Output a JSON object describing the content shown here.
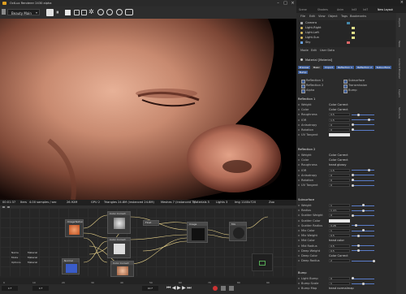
{
  "render_window": {
    "title": "OctLux Renderer 2430 alpha",
    "pass_select": "Beauty Main",
    "stats": {
      "time": "00:01:37",
      "iters": "Iters",
      "samples": "4.00 samples / sec",
      "spp": "26.92M",
      "gpu": "GPU 2",
      "triangles": "Triangles 24.8M (instanced 24.8M)",
      "meshes": "Meshes 7 (instanced 7)",
      "materials": "Materials 5",
      "lights": "Lights 3",
      "img": "Img 1140x720",
      "zoom": "Zoo"
    }
  },
  "node_editor": {
    "nodes": [
      {
        "title": "ImageTexture"
      },
      {
        "title": "Color Correct"
      },
      {
        "title": "Color Correct"
      },
      {
        "title": "Float"
      },
      {
        "title": "Color Correct"
      },
      {
        "title": "Image"
      },
      {
        "title": "Mix"
      },
      {
        "title": "Normal"
      }
    ],
    "properties": [
      {
        "label": "Name",
        "value": "Material"
      },
      {
        "label": "Mode",
        "value": "Material"
      },
      {
        "label": "Options",
        "value": "Material"
      }
    ]
  },
  "timeline": {
    "ticks": [
      "0",
      "10",
      "20",
      "30",
      "40",
      "50",
      "60",
      "70",
      "80",
      "90"
    ],
    "start": "0 F",
    "end": "90 F",
    "current": "0 F"
  },
  "right_panel": {
    "top_tabs": [
      "Scene",
      "Shaders",
      "Anim",
      "Int3",
      "Int7",
      "New Layout"
    ],
    "menu": [
      "File",
      "Edit",
      "View",
      "Object",
      "Tags",
      "Bookmarks"
    ],
    "objects": [
      "Camera",
      "Light.Right",
      "Light.Left",
      "Light.Sun",
      "Sky"
    ],
    "attr_menu": [
      "Mode",
      "Edit",
      "User Data"
    ],
    "material_label": "Material [Material]",
    "preset_buttons": [
      "Preview",
      "Basic",
      "Import",
      "Reflection 1",
      "Reflection 2",
      "Subsurface",
      "Bump"
    ],
    "checkbox_rows": [
      [
        "Reflection 1",
        "Subsurface"
      ],
      [
        "Reflection 2",
        "Transmission"
      ],
      [
        "Alpha",
        "Bump"
      ]
    ],
    "reflection1": {
      "header": "Reflection 1",
      "rows": [
        {
          "label": "Weight",
          "value": "Color Correct"
        },
        {
          "label": "Color",
          "value": "Color Correct"
        },
        {
          "label": "Roughness",
          "value": "0.5"
        },
        {
          "label": "IOR",
          "value": "1.5"
        },
        {
          "label": "Anisotropy",
          "value": "0"
        },
        {
          "label": "Rotation",
          "value": "0"
        },
        {
          "label": "UV Tangent",
          "value": ""
        }
      ]
    },
    "reflection2": {
      "header": "Reflection 2",
      "rows": [
        {
          "label": "Weight",
          "value": "Color Correct"
        },
        {
          "label": "Color",
          "value": "Color Correct"
        },
        {
          "label": "Roughness",
          "value": "head glossy"
        },
        {
          "label": "IOR",
          "value": "1.5"
        },
        {
          "label": "Anisotropy",
          "value": "0"
        },
        {
          "label": "Rotation",
          "value": "0"
        },
        {
          "label": "UV Tangent",
          "value": "0"
        }
      ]
    },
    "subsurface": {
      "header": "Subsurface",
      "rows": [
        {
          "label": "Weight",
          "value": "1"
        },
        {
          "label": "Radius",
          "value": "1 cm"
        },
        {
          "label": "Scatter Weight",
          "value": "0"
        },
        {
          "label": "Scatter Color",
          "value": ""
        },
        {
          "label": "Scatter Radius",
          "value": "0.28"
        },
        {
          "label": "Mix Color",
          "value": "1"
        },
        {
          "label": "Mix Weight",
          "value": "0.5"
        },
        {
          "label": "Mid Color",
          "value": "head color"
        },
        {
          "label": "Mid Radius",
          "value": "0.5"
        },
        {
          "label": "Deep Weight",
          "value": "0.5"
        },
        {
          "label": "Deep Color",
          "value": "Color Correct"
        },
        {
          "label": "Deep Radius",
          "value": "2"
        }
      ]
    },
    "bump": {
      "header": "Bump",
      "rows": [
        {
          "label": "Light Bump",
          "value": "0"
        },
        {
          "label": "Bump Scale",
          "value": "1"
        },
        {
          "label": "Bump Map",
          "value": "head normalmap"
        }
      ]
    },
    "vertical_tabs": [
      "Objects",
      "Takes",
      "Content Browser",
      "Layers",
      "Structure"
    ],
    "accent_color": "#3f5f9b"
  }
}
